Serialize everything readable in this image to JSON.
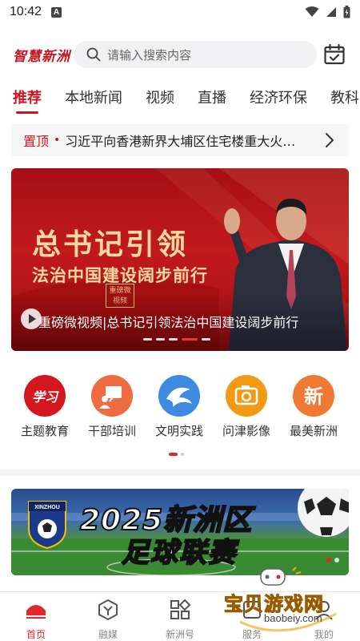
{
  "status": {
    "time": "10:42",
    "notification_glyph": "A"
  },
  "header": {
    "logo_text": "智慧新洲",
    "search_placeholder": "请输入搜索内容"
  },
  "tabs": [
    {
      "label": "推荐",
      "active": true
    },
    {
      "label": "本地新闻",
      "active": false
    },
    {
      "label": "视频",
      "active": false
    },
    {
      "label": "直播",
      "active": false
    },
    {
      "label": "经济环保",
      "active": false
    },
    {
      "label": "教科",
      "active": false
    }
  ],
  "pinned": {
    "tag": "置顶",
    "separator": "•",
    "text": "习近平向香港新界大埔区住宅楼重大火灾遇难者表示深切哀悼"
  },
  "banner": {
    "headline": "总书记引领",
    "subheadline": "法治中国建设阔步前行",
    "seal_text": "重磅微视频",
    "caption": "重磅微视频|总书记引领法治中国建设阔步前行",
    "slides_total": 5,
    "active_slide": 4
  },
  "quick_entries": [
    {
      "label": "主题教育",
      "icon": "xuexi-icon",
      "color": "#d4171e"
    },
    {
      "label": "干部培训",
      "icon": "training-icon",
      "color": "#ef6b42"
    },
    {
      "label": "文明实践",
      "icon": "civilization-icon",
      "color": "#3d8ae0"
    },
    {
      "label": "问津影像",
      "icon": "camera-icon",
      "color": "#f29a16"
    },
    {
      "label": "最美新洲",
      "icon": "xin-icon",
      "color": "#f07a35"
    }
  ],
  "quick_pages": {
    "total": 2,
    "active": 1
  },
  "soccer_card": {
    "title_line1": "2025新洲区",
    "title_line2": "足球联赛",
    "badge_text": "XINZHOU",
    "slides_total": 2,
    "active_slide": 1
  },
  "bottom_nav": [
    {
      "label": "首页",
      "icon": "home-icon",
      "active": true
    },
    {
      "label": "融媒",
      "icon": "media-icon",
      "active": false
    },
    {
      "label": "新洲号",
      "icon": "apps-icon",
      "active": false
    },
    {
      "label": "服务",
      "icon": "service-icon",
      "active": false
    },
    {
      "label": "我的",
      "icon": "profile-icon",
      "active": false
    }
  ],
  "watermark": {
    "text": "宝贝游戏网",
    "url": "baobeiy.com"
  },
  "colors": {
    "brand_red": "#d0141e",
    "accent_gold": "#f7d9a2"
  }
}
